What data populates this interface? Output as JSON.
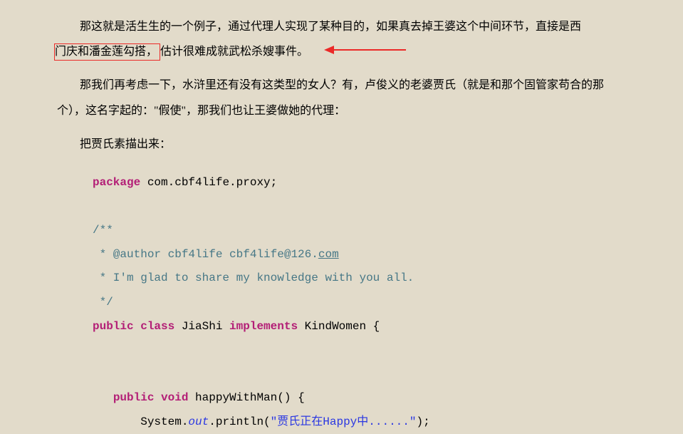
{
  "para1_indent": "　",
  "para1_part1": "那这就是活生生的一个例子，通过代理人实现了某种目的，如果真去掉王婆这个中间环节，直接是西",
  "para1_box": "门庆和潘金莲勾搭，",
  "para1_part2": "估计很难成就武松杀嫂事件。",
  "para2": "那我们再考虑一下，水浒里还有没有这类型的女人？有，卢俊义的老婆贾氏（就是和那个固管家苟合的那个），这名字起的：\"假使\"，那我们也让王婆做她的代理：",
  "para3": "把贾氏素描出来：",
  "code": {
    "l1_kw": "package",
    "l1_rest": " com.cbf4life.proxy;",
    "l2": "",
    "l3": "/**",
    "l4_a": " * @author cbf4life cbf4life@126.",
    "l4_link": "com",
    "l5": " * I'm glad to share my knowledge with you all.",
    "l6": " */",
    "l7_kw1": "public",
    "l7_kw2": " class",
    "l7_name": " JiaShi",
    "l7_kw3": " implements",
    "l7_iface": " KindWomen {",
    "l8": "",
    "l9": "",
    "l10_pad": "   ",
    "l10_kw1": "public",
    "l10_kw2": " void",
    "l10_rest": " happyWithMan() {",
    "l11_pad": "       System.",
    "l11_out": "out",
    "l11_mid": ".println(",
    "l11_str": "\"贾氏正在Happy中......\"",
    "l11_end": ");"
  }
}
